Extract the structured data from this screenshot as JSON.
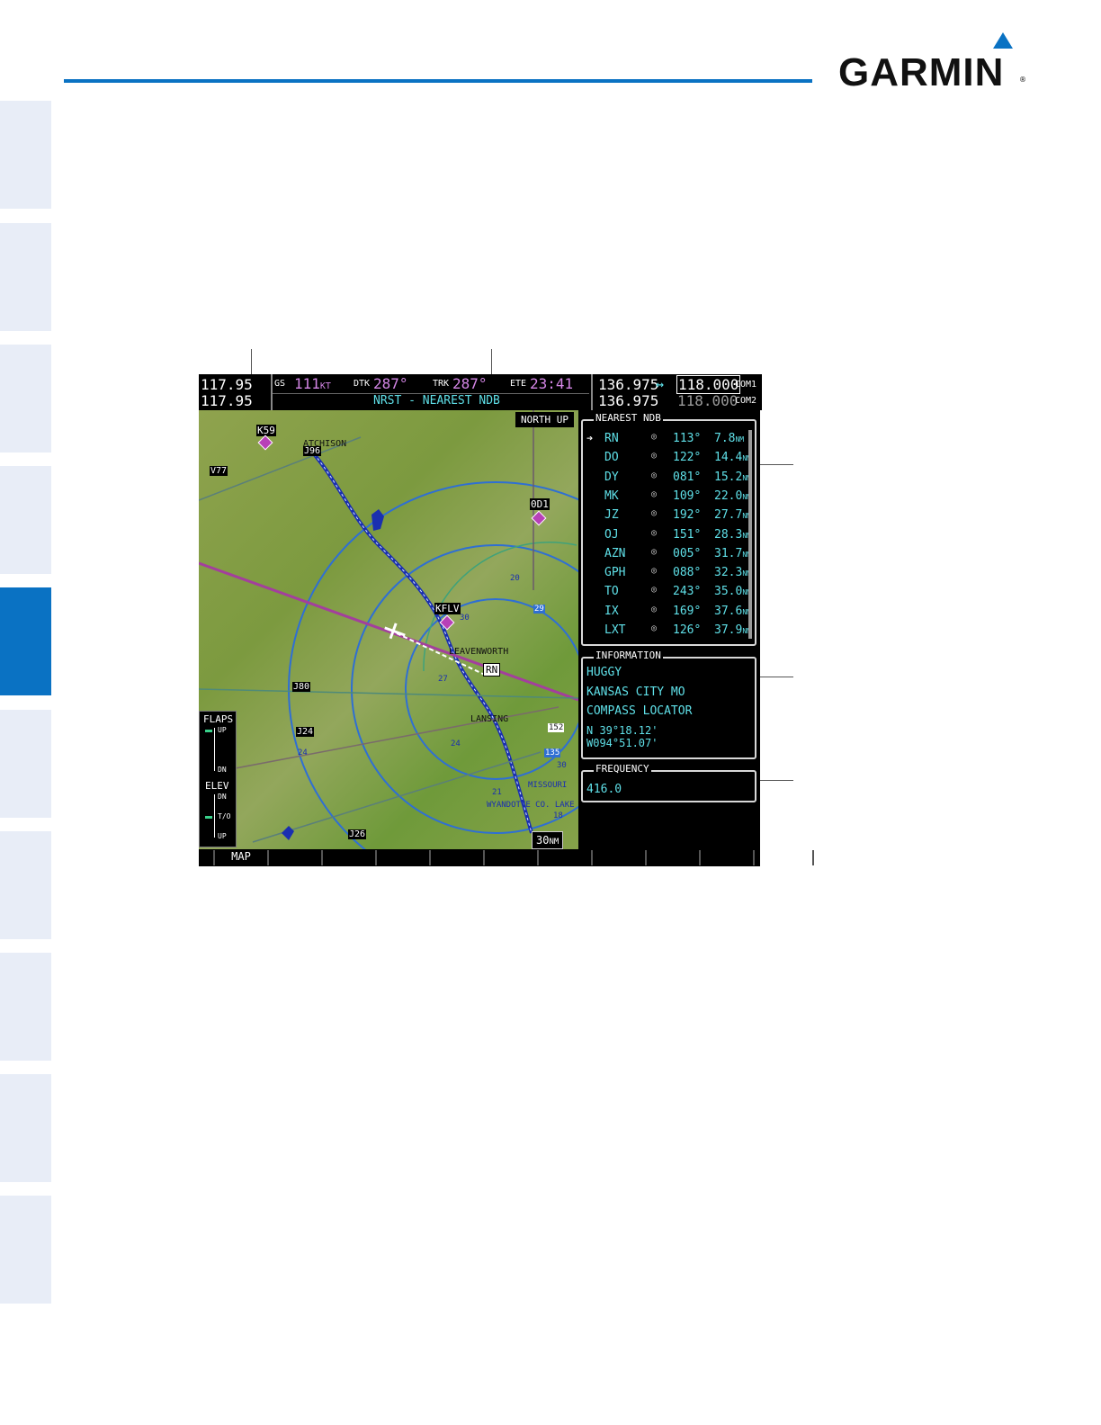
{
  "brand": {
    "name": "GARMIN"
  },
  "colors": {
    "accent": "#0a72c3",
    "tab_active": "#0a72c3",
    "tab_inactive": "#e8edf7",
    "cyan_text": "#5fe0e8",
    "magenta_text": "#d486e6"
  },
  "header": {
    "nav_freq_1": "117.95",
    "nav_freq_2": "117.95",
    "gs_label": "GS",
    "gs_value": "111",
    "gs_unit": "KT",
    "dtk_label": "DTK",
    "dtk_value": "287°",
    "trk_label": "TRK",
    "trk_value": "287°",
    "ete_label": "ETE",
    "ete_value": "23:41",
    "page_title": "NRST - NEAREST NDB",
    "com1_standby": "136.975",
    "com1_active": "118.000",
    "com1_label": "COM1",
    "com2_standby": "136.975",
    "com2_active": "118.000",
    "com2_label": "COM2",
    "swap_icon": "double-arrow-icon"
  },
  "map": {
    "orientation": "NORTH UP",
    "range_value": "30",
    "range_unit": "NM",
    "labels": {
      "k59": "K59",
      "atchison": "ATCHISON",
      "v77": "V77",
      "j96": "J96",
      "od1": "0D1",
      "kflv": "KFLV",
      "leavenworth": "LEAVENWORTH",
      "rn": "RN",
      "j80": "J80",
      "j24": "J24",
      "lansing": "LANSING",
      "missouri": "MISSOURI",
      "wyandotte": "WYANDOTTE CO. LAKE",
      "j26": "J26",
      "n27": "27",
      "n24": "24",
      "n21": "21",
      "n18": "18",
      "n20": "20",
      "n30": "30",
      "n29": "29",
      "n152": "152",
      "n135": "135",
      "n30b": "30",
      "n24b": "24"
    },
    "flaps": {
      "title": "FLAPS",
      "up": "UP",
      "dn": "DN"
    },
    "elev": {
      "title": "ELEV",
      "dn": "DN",
      "to": "T/O",
      "up": "UP"
    }
  },
  "nearest_ndb": {
    "title": "NEAREST NDB",
    "rows": [
      {
        "ident": "RN",
        "bearing": "113°",
        "distance": "7.8",
        "unit": "NM",
        "selected": true
      },
      {
        "ident": "DO",
        "bearing": "122°",
        "distance": "14.4",
        "unit": "NM"
      },
      {
        "ident": "DY",
        "bearing": "081°",
        "distance": "15.2",
        "unit": "NM"
      },
      {
        "ident": "MK",
        "bearing": "109°",
        "distance": "22.0",
        "unit": "NM"
      },
      {
        "ident": "JZ",
        "bearing": "192°",
        "distance": "27.7",
        "unit": "NM"
      },
      {
        "ident": "OJ",
        "bearing": "151°",
        "distance": "28.3",
        "unit": "NM"
      },
      {
        "ident": "AZN",
        "bearing": "005°",
        "distance": "31.7",
        "unit": "NM"
      },
      {
        "ident": "GPH",
        "bearing": "088°",
        "distance": "32.3",
        "unit": "NM"
      },
      {
        "ident": "TO",
        "bearing": "243°",
        "distance": "35.0",
        "unit": "NM"
      },
      {
        "ident": "IX",
        "bearing": "169°",
        "distance": "37.6",
        "unit": "NM"
      },
      {
        "ident": "LXT",
        "bearing": "126°",
        "distance": "37.9",
        "unit": "NM"
      }
    ]
  },
  "information": {
    "title": "INFORMATION",
    "name": "HUGGY",
    "city": "KANSAS CITY MO",
    "type": "COMPASS LOCATOR",
    "lat": "N 39°18.12'",
    "lon": "W094°51.07'"
  },
  "frequency": {
    "title": "FREQUENCY",
    "value": "416.0"
  },
  "softkeys": [
    "",
    "MAP",
    "",
    "",
    "",
    "",
    "",
    "",
    "",
    "",
    "",
    ""
  ]
}
